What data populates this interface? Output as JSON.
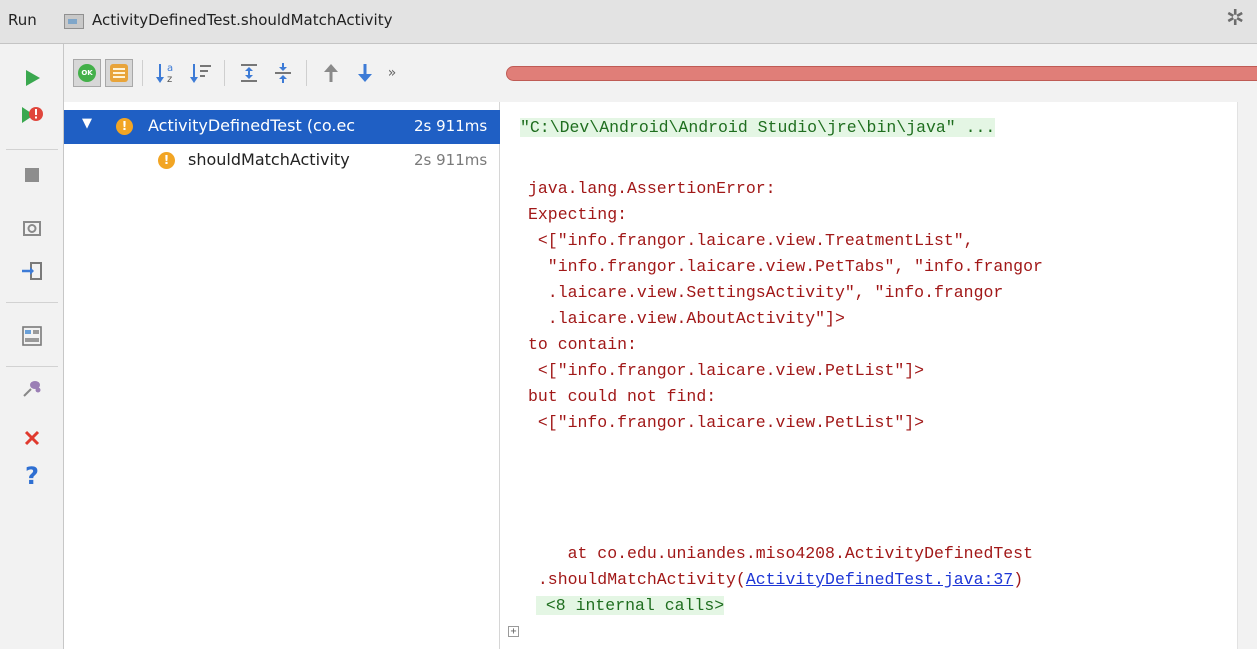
{
  "window": {
    "tool_name": "Run",
    "config_title": "ActivityDefinedTest.shouldMatchActivity",
    "settings_icon": "gear-icon"
  },
  "left_toolbar": {
    "icons": [
      "rerun-icon",
      "rerun-failed-icon",
      "stop-icon",
      "camera-icon",
      "import-icon",
      "layout-icon",
      "pin-icon",
      "close-icon",
      "help-icon"
    ]
  },
  "top_toolbar": {
    "toggle_ok_label": "OK",
    "icons": [
      "show-passed-icon",
      "show-ignored-icon",
      "sort-alpha-icon",
      "sort-duration-icon",
      "expand-all-icon",
      "collapse-all-icon",
      "prev-failed-icon",
      "next-failed-icon"
    ],
    "overflow": "»",
    "progress": {
      "fraction": 1.0,
      "status": "failed",
      "color": "#e07e78"
    }
  },
  "test_tree": [
    {
      "name": "ActivityDefinedTest (co.ec",
      "duration": "2s 911ms",
      "status": "failed",
      "selected": true
    },
    {
      "name": "shouldMatchActivity",
      "duration": "2s 911ms",
      "status": "failed",
      "selected": false
    }
  ],
  "console": {
    "command": "\"C:\\Dev\\Android\\Android Studio\\jre\\bin\\java\" ...",
    "lines": [
      "java.lang.AssertionError:",
      "Expecting:",
      " <[\"info.frangor.laicare.view.TreatmentList\",",
      "  \"info.frangor.laicare.view.PetTabs\", \"info.frangor",
      "  .laicare.view.SettingsActivity\", \"info.frangor",
      "  .laicare.view.AboutActivity\"]>",
      "to contain:",
      " <[\"info.frangor.laicare.view.PetList\"]>",
      "but could not find:",
      " <[\"info.frangor.laicare.view.PetList\"]>"
    ],
    "stack_at": "    at co.edu.uniandes.miso4208.ActivityDefinedTest",
    "stack_method": " .shouldMatchActivity(",
    "stack_link": "ActivityDefinedTest.java:37",
    "stack_close": ")",
    "fold_sign": "+",
    "internal_calls": " <8 internal calls>"
  },
  "colors": {
    "selection": "#1f5fc4",
    "error_text": "#a11818",
    "highlight_bg": "#e4f6e4",
    "link": "#1d36d6",
    "warning": "#f2a524"
  }
}
